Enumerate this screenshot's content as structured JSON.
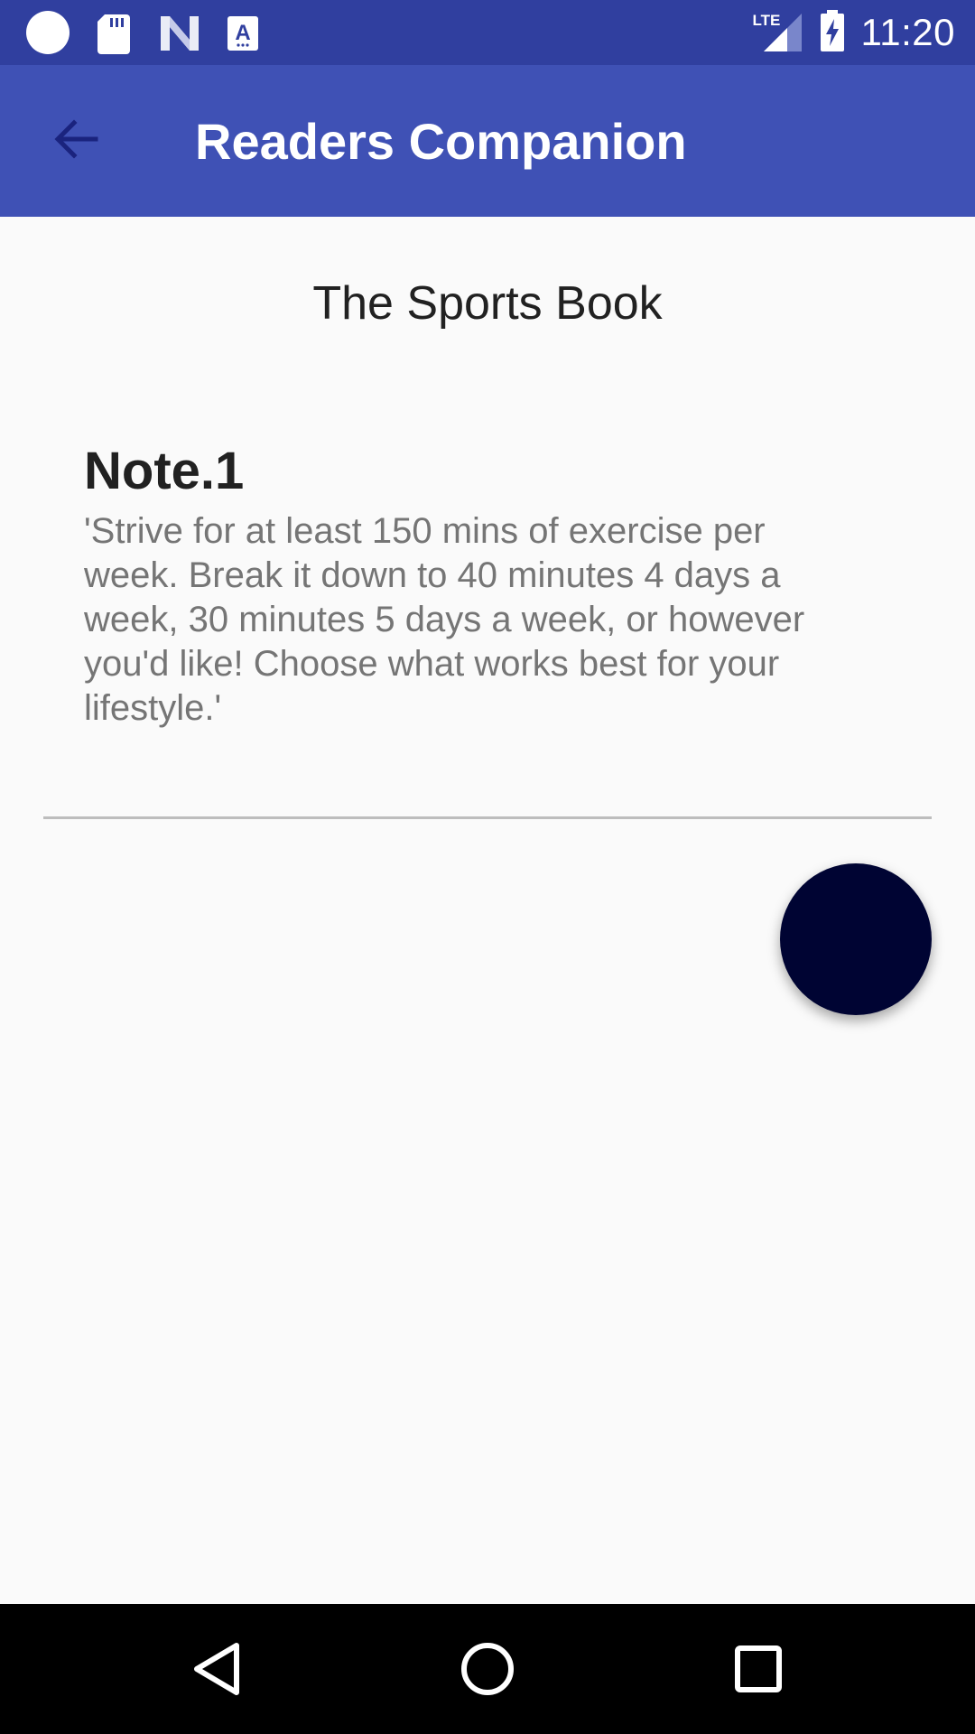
{
  "status_bar": {
    "time": "11:20",
    "network": "LTE",
    "icons": [
      "circle-icon",
      "sd-card-icon",
      "n-logo-icon",
      "a-text-icon",
      "lte-signal-icon",
      "battery-charging-icon"
    ]
  },
  "app_bar": {
    "title": "Readers Companion",
    "back_icon": "arrow-back-icon"
  },
  "book": {
    "title": "The Sports Book"
  },
  "note": {
    "title": "Note.1",
    "body": "'Strive for at least 150 mins of exercise per week. Break it down to 40 minutes 4 days a week, 30 minutes 5 days a week, or however you'd like! Choose what works best for your lifestyle.'"
  },
  "fab": {
    "color": "#000433"
  },
  "nav_bar": {
    "icons": [
      "back-triangle-icon",
      "home-circle-icon",
      "recents-square-icon"
    ]
  },
  "colors": {
    "status_bar": "#303f9f",
    "app_bar": "#3f51b5",
    "background": "#fafafa"
  }
}
